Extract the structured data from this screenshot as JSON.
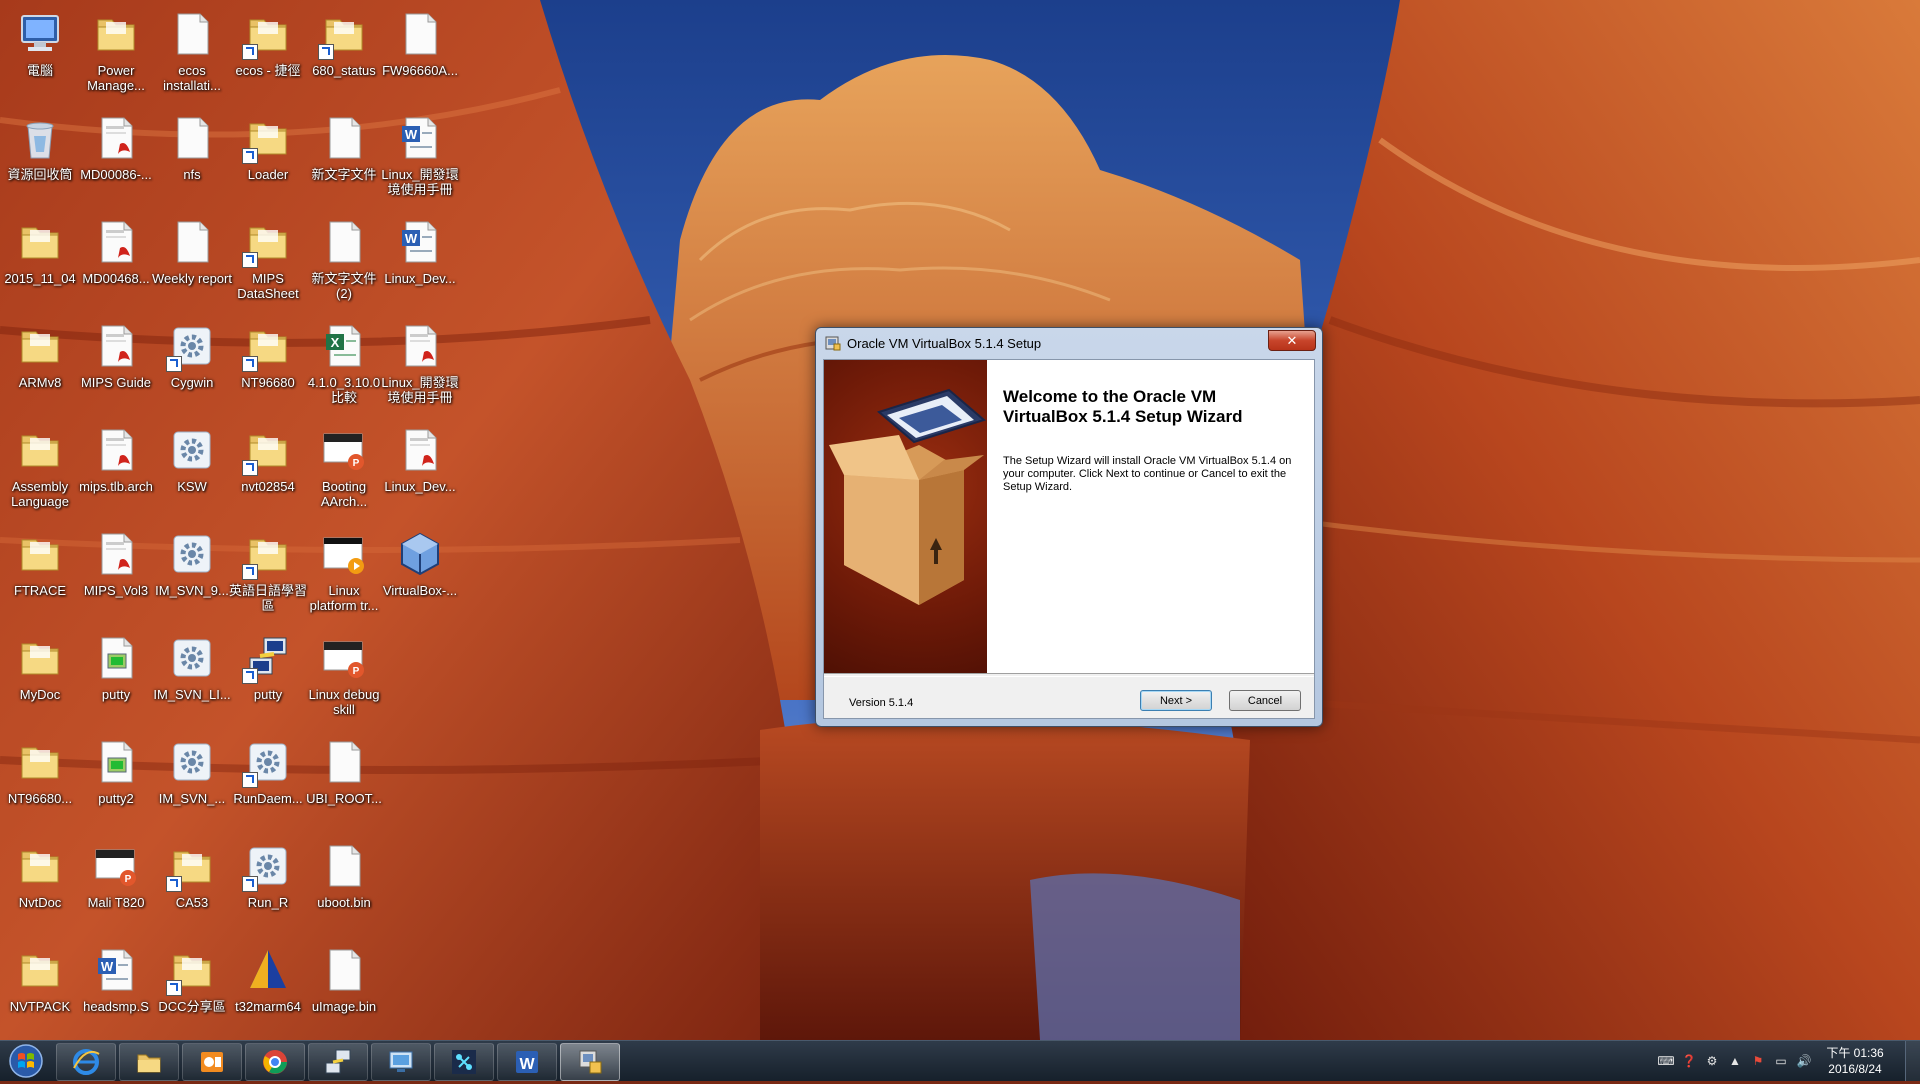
{
  "desktop": {
    "icons": [
      {
        "label": "電腦",
        "type": "computer"
      },
      {
        "label": "Power Manage...",
        "type": "folder"
      },
      {
        "label": "ecos installati...",
        "type": "file"
      },
      {
        "label": "ecos - 捷徑",
        "type": "folder-shortcut"
      },
      {
        "label": "680_status",
        "type": "folder-shortcut"
      },
      {
        "label": "FW96660A...",
        "type": "file"
      },
      {
        "label": "資源回收筒",
        "type": "recycle"
      },
      {
        "label": "MD00086-...",
        "type": "pdf"
      },
      {
        "label": "nfs",
        "type": "file"
      },
      {
        "label": "Loader",
        "type": "folder-shortcut"
      },
      {
        "label": "新文字文件",
        "type": "file"
      },
      {
        "label": "Linux_開發環境使用手冊",
        "type": "word"
      },
      {
        "label": "2015_11_04",
        "type": "folder"
      },
      {
        "label": "MD00468...",
        "type": "pdf"
      },
      {
        "label": "Weekly report",
        "type": "file"
      },
      {
        "label": "MIPS DataSheet",
        "type": "folder-shortcut"
      },
      {
        "label": "新文字文件 (2)",
        "type": "file"
      },
      {
        "label": "Linux_Dev...",
        "type": "word"
      },
      {
        "label": "ARMv8",
        "type": "folder"
      },
      {
        "label": "MIPS Guide",
        "type": "pdf"
      },
      {
        "label": "Cygwin",
        "type": "gear-shortcut"
      },
      {
        "label": "NT96680",
        "type": "folder-shortcut"
      },
      {
        "label": "4.1.0_3.10.0 比較",
        "type": "excel"
      },
      {
        "label": "Linux_開發環境使用手冊",
        "type": "pdf"
      },
      {
        "label": "Assembly Language",
        "type": "folder"
      },
      {
        "label": "mips.tlb.arch",
        "type": "pdf"
      },
      {
        "label": "KSW",
        "type": "gear"
      },
      {
        "label": "nvt02854",
        "type": "folder-shortcut"
      },
      {
        "label": "Booting AArch...",
        "type": "ppt"
      },
      {
        "label": "Linux_Dev...",
        "type": "pdf"
      },
      {
        "label": "FTRACE",
        "type": "folder"
      },
      {
        "label": "MIPS_Vol3",
        "type": "pdf"
      },
      {
        "label": "IM_SVN_9...",
        "type": "gear"
      },
      {
        "label": "英語日語學習區",
        "type": "folder-shortcut"
      },
      {
        "label": "Linux platform tr...",
        "type": "video"
      },
      {
        "label": "VirtualBox-...",
        "type": "vbox"
      },
      {
        "label": "MyDoc",
        "type": "folder"
      },
      {
        "label": "putty",
        "type": "putty-file"
      },
      {
        "label": "IM_SVN_LI...",
        "type": "gear"
      },
      {
        "label": "putty",
        "type": "putty"
      },
      {
        "label": "Linux debug skill",
        "type": "ppt"
      },
      {
        "label": "",
        "type": "none"
      },
      {
        "label": "NT96680...",
        "type": "folder"
      },
      {
        "label": "putty2",
        "type": "putty-file"
      },
      {
        "label": "IM_SVN_...",
        "type": "gear"
      },
      {
        "label": "RunDaem...",
        "type": "gear-shortcut"
      },
      {
        "label": "UBI_ROOT...",
        "type": "file"
      },
      {
        "label": "",
        "type": "none"
      },
      {
        "label": "NvtDoc",
        "type": "folder"
      },
      {
        "label": "Mali T820",
        "type": "ppt"
      },
      {
        "label": "CA53",
        "type": "folder-shortcut"
      },
      {
        "label": "Run_R",
        "type": "gear-shortcut"
      },
      {
        "label": "uboot.bin",
        "type": "file"
      },
      {
        "label": "",
        "type": "none"
      },
      {
        "label": "NVTPACK",
        "type": "folder"
      },
      {
        "label": "headsmp.S",
        "type": "word"
      },
      {
        "label": "DCC分享區",
        "type": "folder-shortcut"
      },
      {
        "label": "t32marm64",
        "type": "t32"
      },
      {
        "label": "uImage.bin",
        "type": "file"
      },
      {
        "label": "",
        "type": "none"
      }
    ]
  },
  "setup": {
    "title": "Oracle VM VirtualBox 5.1.4 Setup",
    "close_label": "✕",
    "welcome_title": "Welcome to the Oracle VM VirtualBox 5.1.4 Setup Wizard",
    "welcome_body": "The Setup Wizard will install Oracle VM VirtualBox 5.1.4 on your computer. Click Next to continue or Cancel to exit the Setup Wizard.",
    "version": "Version 5.1.4",
    "next_label": "Next >",
    "cancel_label": "Cancel"
  },
  "taskbar": {
    "items": [
      {
        "name": "internet-explorer",
        "active": false
      },
      {
        "name": "file-explorer",
        "active": false
      },
      {
        "name": "outlook",
        "active": false
      },
      {
        "name": "chrome",
        "active": false
      },
      {
        "name": "putty",
        "active": false
      },
      {
        "name": "remote-desktop",
        "active": false
      },
      {
        "name": "network-app",
        "active": false
      },
      {
        "name": "word",
        "active": false
      },
      {
        "name": "virtualbox-setup",
        "active": true
      }
    ],
    "clock": {
      "time": "下午 01:36",
      "date": "2016/8/24"
    }
  },
  "colors": {
    "taskbar": "#16202b",
    "dialog_frame": "#c9d7ea",
    "banner": "#7a1e0a"
  }
}
